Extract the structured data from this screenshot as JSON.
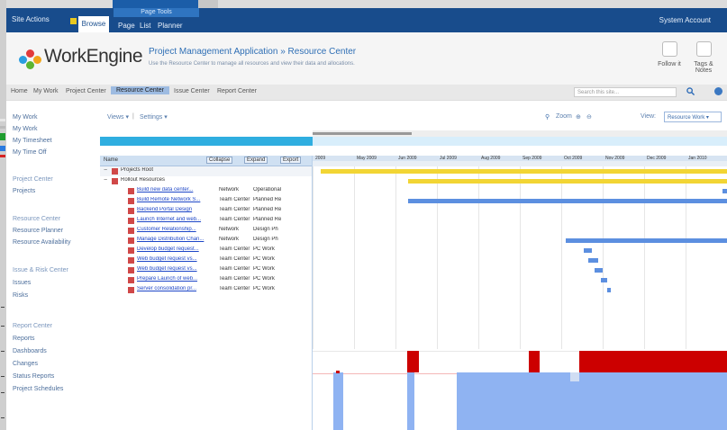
{
  "ribbon": {
    "site_actions": "Site Actions",
    "browse_tab": "Browse",
    "page_tools": "Page Tools",
    "tabs": [
      "Page",
      "List",
      "Planner"
    ],
    "user": "System Account"
  },
  "header": {
    "brand": "WorkEngine",
    "app_title": "Project Management Application",
    "title_separator": "»",
    "page_title": "Resource Center",
    "description": "Use the Resource Center to manage all resources and view their data and allocations.",
    "buttons": [
      {
        "label": "Follow it"
      },
      {
        "label": "Tags & Notes"
      }
    ]
  },
  "topnav": {
    "items": [
      {
        "label": "Home",
        "active": false
      },
      {
        "label": "My Work",
        "active": false
      },
      {
        "label": "Project Center",
        "active": false
      },
      {
        "label": "Resource Center",
        "active": true
      },
      {
        "label": "Issue Center",
        "active": false
      },
      {
        "label": "Report Center",
        "active": false
      }
    ],
    "search_placeholder": "Search this site..."
  },
  "leftnav": {
    "sections": [
      {
        "heading": "My Work",
        "items": [
          "My Work",
          "My Timesheet",
          "My Time Off"
        ]
      },
      {
        "heading": "Project Center",
        "items": [
          "Projects"
        ]
      },
      {
        "heading": "Resource Center",
        "items": [
          "Resource Planner",
          "Resource Availability"
        ]
      },
      {
        "heading": "Issue & Risk Center",
        "items": [
          "Issues",
          "Risks"
        ]
      },
      {
        "heading": "Report Center",
        "items": [
          "Reports",
          "Dashboards",
          "Changes",
          "Status Reports",
          "Project Schedules"
        ]
      }
    ]
  },
  "toolbar": {
    "views_menu": "Views ▾",
    "settings_menu": "Settings ▾",
    "zoom": "Zoom",
    "view_label": "View:",
    "view_value": "Resource Work ▾"
  },
  "grid": {
    "headers": {
      "name": "Name",
      "collapse": "Collapse",
      "expand": "Expand",
      "export": "Export"
    },
    "rows": [
      {
        "level": 0,
        "name": "Projects Root",
        "link": false,
        "col1": "",
        "col2": ""
      },
      {
        "level": 0,
        "name": "Rollout Resources",
        "link": false,
        "col1": "",
        "col2": ""
      },
      {
        "level": 1,
        "name": "Build new data center...",
        "link": true,
        "col1": "Network",
        "col2": "Operational"
      },
      {
        "level": 1,
        "name": "Build Remote Network S...",
        "link": true,
        "col1": "Team Center",
        "col2": "Planned Re"
      },
      {
        "level": 1,
        "name": "Backend Portal Design",
        "link": true,
        "col1": "Team Center",
        "col2": "Planned Re"
      },
      {
        "level": 1,
        "name": "Launch Internet and web...",
        "link": true,
        "col1": "Team Center",
        "col2": "Planned Re"
      },
      {
        "level": 1,
        "name": "Customer Relationship...",
        "link": true,
        "col1": "Network",
        "col2": "Design Ph"
      },
      {
        "level": 1,
        "name": "Manage Distribution Chan...",
        "link": true,
        "col1": "Network",
        "col2": "Design Ph"
      },
      {
        "level": 1,
        "name": "Develop budget request...",
        "link": true,
        "col1": "Team Center",
        "col2": "PC Work"
      },
      {
        "level": 1,
        "name": "Web budget request vs...",
        "link": true,
        "col1": "Team Center",
        "col2": "PC Work"
      },
      {
        "level": 1,
        "name": "Web budget request vs...",
        "link": true,
        "col1": "Team Center",
        "col2": "PC Work"
      },
      {
        "level": 1,
        "name": "Prepare Launch of web...",
        "link": true,
        "col1": "Team Center",
        "col2": "PC Work"
      },
      {
        "level": 1,
        "name": "Server consolidation pr...",
        "link": true,
        "col1": "Team Center",
        "col2": "PC Work"
      }
    ]
  },
  "gantt": {
    "months": [
      "2009",
      "May 2009",
      "Jun 2009",
      "Jul 2009",
      "Aug 2009",
      "Sep 2009",
      "Oct 2009",
      "Nov 2009",
      "Dec 2009",
      "Jan 2010"
    ],
    "bars": [
      {
        "row": 0,
        "start": 0.02,
        "end": 1.0,
        "color": "#f2d534"
      },
      {
        "row": 1,
        "start": 0.23,
        "end": 1.0,
        "color": "#f2d534"
      },
      {
        "row": 2,
        "start": 0.99,
        "end": 1.0,
        "color": "#5c8fe0"
      },
      {
        "row": 3,
        "start": 0.23,
        "end": 1.0,
        "color": "#5c8fe0"
      },
      {
        "row": 7,
        "start": 0.61,
        "end": 1.0,
        "color": "#5c8fe0"
      },
      {
        "row": 8,
        "start": 0.655,
        "end": 0.675,
        "color": "#5c8fe0"
      },
      {
        "row": 9,
        "start": 0.665,
        "end": 0.69,
        "color": "#5c8fe0"
      },
      {
        "row": 10,
        "start": 0.68,
        "end": 0.7,
        "color": "#5c8fe0"
      },
      {
        "row": 11,
        "start": 0.695,
        "end": 0.71,
        "color": "#5c8fe0"
      },
      {
        "row": 12,
        "start": 0.71,
        "end": 0.72,
        "color": "#5c8fe0"
      }
    ]
  },
  "colors": {
    "ribbon": "#184c8c",
    "accent": "#2faee0",
    "overallocation": "#cc0000",
    "allocation": "#8fb3f2",
    "gantt_summary": "#f2d534",
    "gantt_task": "#5c8fe0"
  }
}
